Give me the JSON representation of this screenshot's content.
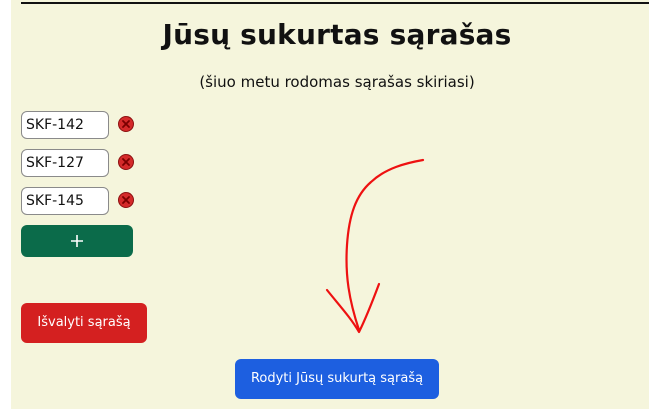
{
  "header": {
    "title": "Jūsų sukurtas sąrašas",
    "subtitle": "(šiuo metu rodomas sąrašas skiriasi)"
  },
  "list": {
    "items": [
      {
        "value": "SKF-142"
      },
      {
        "value": "SKF-127"
      },
      {
        "value": "SKF-145"
      }
    ],
    "remove_icon": "close-circle-icon",
    "add_icon": "plus-icon"
  },
  "actions": {
    "clear_label": "Išvalyti sąrašą",
    "show_label": "Rodyti Jūsų sukurtą sąrašą"
  },
  "annotation": {
    "icon": "hand-drawn-arrow-icon",
    "color": "#ee1111"
  },
  "colors": {
    "background": "#f5f5dc",
    "add": "#0b6b4a",
    "clear": "#d42020",
    "show": "#1d5fe0"
  }
}
